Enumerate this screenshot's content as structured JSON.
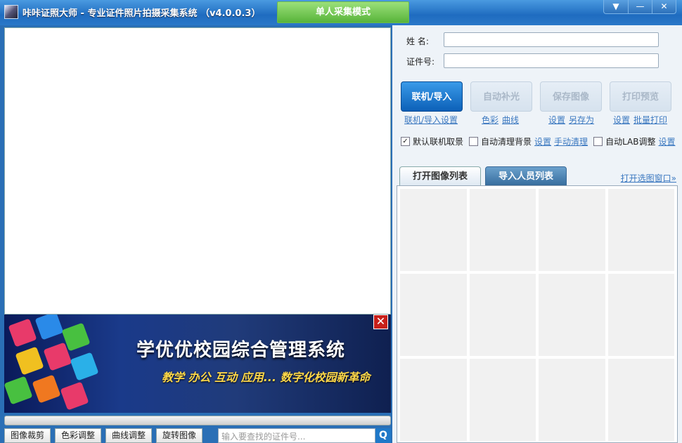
{
  "window": {
    "title": "咔咔证照大师 - 专业证件照片拍摄采集系统 （v4.0.0.3）",
    "mode_tab": "单人采集模式",
    "controls": [
      "menu-icon",
      "minimize-icon",
      "close-icon"
    ]
  },
  "banner": {
    "headline": "学优优校园综合管理系统",
    "tagline": "教学 办公 互动 应用... 数字化校园新革命"
  },
  "bottom_tools": {
    "crop": "图像裁剪",
    "color": "色彩调整",
    "curve": "曲线调整",
    "rotate": "旋转图像",
    "search_placeholder": "输入要查找的证件号..."
  },
  "form": {
    "name_label": "姓  名:",
    "id_label": "证件号:",
    "name_value": "",
    "id_value": ""
  },
  "actions": {
    "connect": "联机/导入",
    "fill_light": "自动补光",
    "save_image": "保存图像",
    "print_preview": "打印预览",
    "connect_settings": "联机/导入设置",
    "color": "色彩",
    "curve": "曲线",
    "settings1": "设置",
    "save_as": "另存为",
    "settings2": "设置",
    "batch_print": "批量打印"
  },
  "options": {
    "default_capture": "默认联机取景",
    "default_capture_checked": true,
    "auto_clear_bg": "自动清理背景",
    "auto_clear_bg_checked": false,
    "settings": "设置",
    "manual_clear": "手动清理",
    "auto_lab": "自动LAB调整",
    "auto_lab_checked": false,
    "lab_settings": "设置"
  },
  "tabs": {
    "open_list": "打开图像列表",
    "import_list": "导入人员列表",
    "open_window": "打开选图窗口»"
  },
  "thumbnail_count": 12
}
